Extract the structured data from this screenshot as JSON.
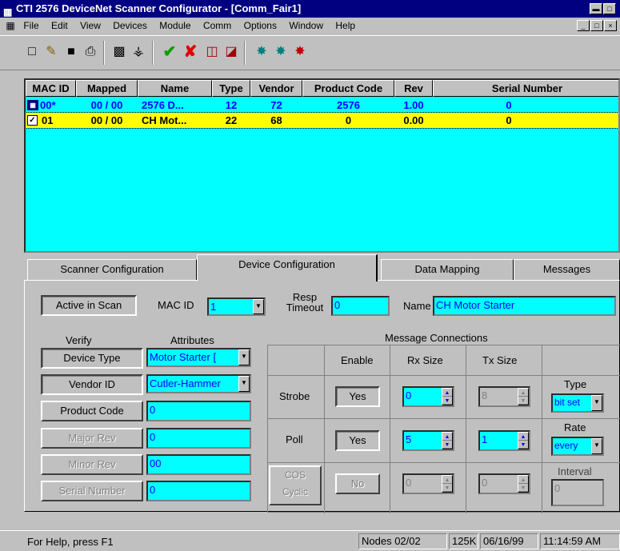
{
  "window": {
    "title": "CTI 2576 DeviceNet Scanner Configurator - [Comm_Fair1]"
  },
  "menu": [
    "File",
    "Edit",
    "View",
    "Devices",
    "Module",
    "Comm",
    "Options",
    "Window",
    "Help"
  ],
  "toolbar_icons": [
    "new-icon",
    "open-icon",
    "save-icon",
    "print-icon",
    "keyboard-icon",
    "filter-icon",
    "check-icon",
    "cross-icon",
    "upload-icon",
    "download-icon",
    "network-icon",
    "network-scan-icon",
    "network-error-icon"
  ],
  "grid": {
    "headers": [
      "MAC ID",
      "Mapped",
      "Name",
      "Type",
      "Vendor",
      "Product Code",
      "Rev",
      "Serial Number"
    ],
    "rows": [
      [
        "00*",
        "00 / 00",
        "2576 D...",
        "12",
        "72",
        "2576",
        "1.00",
        "0"
      ],
      [
        "01",
        "00 / 00",
        "CH Mot...",
        "22",
        "68",
        "0",
        "0.00",
        "0"
      ]
    ]
  },
  "tabs": [
    "Scanner Configuration",
    "Device Configuration",
    "Data Mapping",
    "Messages"
  ],
  "device": {
    "active_label": "Active in Scan",
    "mac_label": "MAC ID",
    "mac_value": "1",
    "resp_label_1": "Resp",
    "resp_label_2": "Timeout",
    "resp_value": "0",
    "name_label": "Name",
    "name_value": "CH Motor Starter",
    "verify_header": "Verify",
    "attr_header": "Attributes",
    "verify": [
      "Device Type",
      "Vendor ID",
      "Product Code",
      "Major Rev",
      "Minor Rev",
      "Serial Number"
    ],
    "attrs": [
      "Motor Starter  [",
      "Cutler-Hammer",
      "0",
      "0",
      "00",
      "0"
    ]
  },
  "msg": {
    "title": "Message Connections",
    "enable": "Enable",
    "rx": "Rx Size",
    "tx": "Tx Size",
    "strobe": "Strobe",
    "poll": "Poll",
    "cos1": "COS",
    "cos2": "Cyclic",
    "yes": "Yes",
    "no": "No",
    "strobe_rx": "0",
    "strobe_tx": "8",
    "poll_rx": "5",
    "poll_tx": "1",
    "cos_rx": "0",
    "cos_tx": "0",
    "type_label": "Type",
    "type_value": "bit set",
    "rate_label": "Rate",
    "rate_value": "every",
    "interval_label": "Interval",
    "interval_value": "0"
  },
  "status": {
    "help": "For Help, press F1",
    "nodes": "Nodes 02/02",
    "baud": "125K",
    "date": "06/16/99",
    "time": "11:14:59 AM"
  }
}
